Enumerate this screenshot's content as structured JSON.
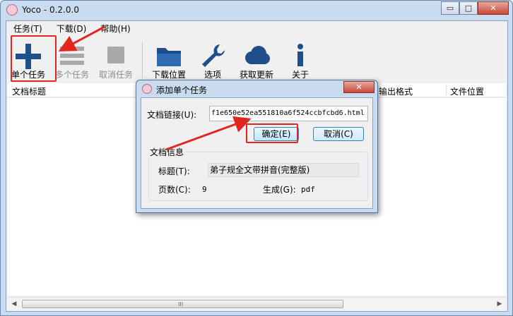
{
  "window": {
    "title": "Yoco - 0.2.0.0",
    "minimize_icon": "minimize-icon",
    "maximize_icon": "maximize-icon",
    "close_icon": "close-icon",
    "min_glyph": "▭",
    "max_glyph": "□",
    "close_glyph": "✕"
  },
  "menu": [
    {
      "label": "任务(T)"
    },
    {
      "label": "下载(D)"
    },
    {
      "label": "帮助(H)"
    }
  ],
  "toolbar": [
    {
      "label": "单个任务",
      "icon": "plus-icon",
      "enabled": true
    },
    {
      "label": "多个任务",
      "icon": "list-icon",
      "enabled": false
    },
    {
      "label": "取消任务",
      "icon": "stop-icon",
      "enabled": false
    },
    {
      "label": "下载位置",
      "icon": "folder-icon",
      "enabled": true
    },
    {
      "label": "选项",
      "icon": "wrench-icon",
      "enabled": true
    },
    {
      "label": "获取更新",
      "icon": "cloud-icon",
      "enabled": true
    },
    {
      "label": "关于",
      "icon": "info-icon",
      "enabled": true
    }
  ],
  "list": {
    "columns": [
      "文档标题",
      "输出格式",
      "文件位置"
    ],
    "scroll_grip": "III",
    "scroll_left": "◀",
    "scroll_right": "▶"
  },
  "dialog": {
    "title": "添加单个任务",
    "close_glyph": "✕",
    "url_label": "文档链接(U):",
    "url_value": "f1e650e52ea551810a6f524ccbfcbd6.html",
    "ok_label": "确定(E)",
    "cancel_label": "取消(C)",
    "group_label": "文档信息",
    "doc_title_label": "标题(T):",
    "doc_title_value": "弟子规全文带拼音(完整版)",
    "pages_label": "页数(C):",
    "pages_value": "9",
    "output_label": "生成(G):",
    "output_value": "pdf"
  },
  "colors": {
    "highlight": "#e1261f",
    "icon_blue": "#1f4f8a",
    "icon_gray": "#a9a9a9"
  }
}
